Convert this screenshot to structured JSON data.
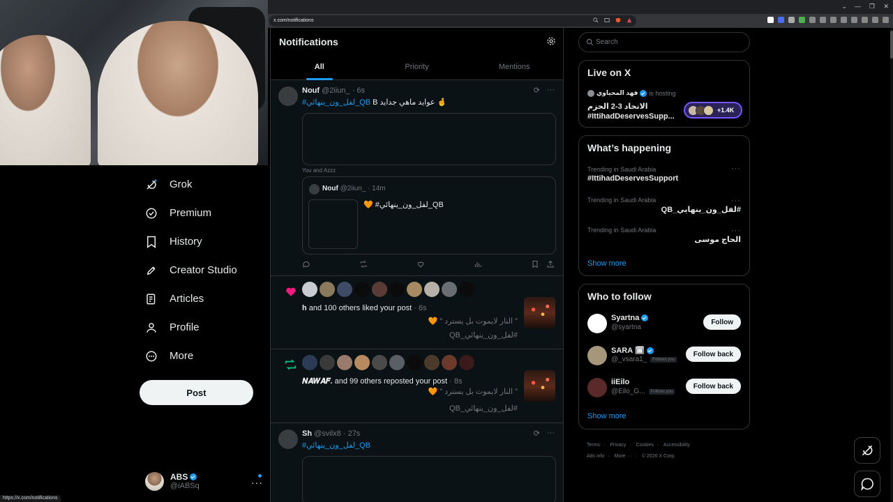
{
  "browser": {
    "url": "x.com/notifications",
    "status_url": "https://x.com/notifications",
    "window_controls": [
      "⌄",
      "—",
      "❐",
      "✕"
    ]
  },
  "nav": {
    "items": [
      {
        "label": "Grok",
        "icon": "grok-icon"
      },
      {
        "label": "Premium",
        "icon": "premium-icon"
      },
      {
        "label": "History",
        "icon": "bookmark-icon"
      },
      {
        "label": "Creator Studio",
        "icon": "rocket-icon"
      },
      {
        "label": "Articles",
        "icon": "article-icon"
      },
      {
        "label": "Profile",
        "icon": "person-icon"
      },
      {
        "label": "More",
        "icon": "more-circle-icon"
      }
    ],
    "post_label": "Post",
    "account": {
      "name": "ABS",
      "handle": "@iABSq",
      "more": "···"
    }
  },
  "main": {
    "title": "Notifications",
    "tabs": [
      {
        "label": "All",
        "active": true
      },
      {
        "label": "Priority",
        "active": false
      },
      {
        "label": "Mentions",
        "active": false
      }
    ],
    "notif1": {
      "name": "Nouf",
      "handle": "@2iiun_ · 6s",
      "hashtag": "#لفل_ون_ينهائي_QB",
      "text": "B  عوايد ماهي جدايد 🤞",
      "you_line": "You and Azzz",
      "quote": {
        "name": "Nouf",
        "handle": "@2iiun_ · 14m",
        "text": "🧡 #لفل_ون_ينهائي_QB"
      }
    },
    "notif2": {
      "text_bold": "h",
      "text_rest": " and 100 others liked your post",
      "time": " · 6s",
      "quote_line": "\" النار لايموت بل يسترد \" 🧡",
      "hashtag_line": "#لفل_ون_ينهائي_QB"
    },
    "notif3": {
      "text_bold": "𝑵𝑨𝑾𝑨𝑭.",
      "text_rest": " and 99 others reposted your post",
      "time": " · 8s",
      "quote_line": "\" النار لايموت بل يسترد \" 🧡",
      "hashtag_line": "#لفل_ون_ينهائي_QB"
    },
    "notif4": {
      "name": "Sh",
      "handle": "@svilx8 · 27s",
      "hashtag": "#لفل_ون_ينهائي_QB"
    }
  },
  "sidebar": {
    "search_placeholder": "Search",
    "live": {
      "title": "Live on X",
      "host_name": "فهد المحياوي",
      "host_suffix": "is hosting",
      "line1": "الاتحاد 3-2 الحزم",
      "line2": "#IttihadDeservesSupp...",
      "count": "+1.4K"
    },
    "happening": {
      "title": "What’s happening",
      "trends": [
        {
          "label": "Trending in Saudi Arabia",
          "name": "#IttihadDeservesSupport",
          "rtl": false
        },
        {
          "label": "Trending in Saudi Arabia",
          "name": "#لفل_ون_ينهايي_QB",
          "rtl": true
        },
        {
          "label": "Trending in Saudi Arabia",
          "name": "الحاج موسى",
          "rtl": true
        }
      ],
      "show_more": "Show more"
    },
    "who_to_follow": {
      "title": "Who to follow",
      "users": [
        {
          "name": "Syartna",
          "handle": "@syartna",
          "follows_you": "",
          "button": "Follow"
        },
        {
          "name": "SARA 🗓",
          "handle": "@_vsara1_",
          "follows_you": "Follows you",
          "button": "Follow back"
        },
        {
          "name": "iiEilo",
          "handle": "@Eilo_G...",
          "follows_you": "Follows you",
          "button": "Follow back"
        }
      ],
      "show_more": "Show more"
    },
    "footer": {
      "links": [
        "Terms",
        "·",
        "Privacy",
        "·",
        "Cookies",
        "·",
        "Accessibility"
      ],
      "links2": [
        "Ads info",
        "·",
        "More ···",
        "·",
        "© 2026 X Corp."
      ]
    }
  },
  "colors": {
    "accent": "#1d9bf0",
    "bg": "#000000",
    "border": "#2f3336",
    "muted": "#71767b",
    "like": "#f91880",
    "repost": "#00ba7c"
  }
}
